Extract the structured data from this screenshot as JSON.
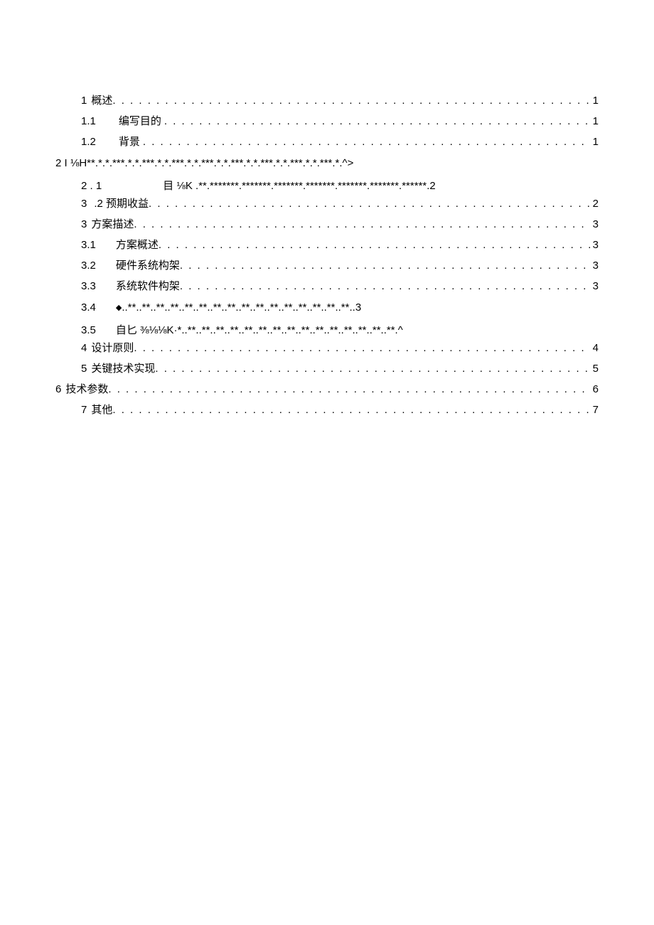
{
  "toc": {
    "items": [
      {
        "kind": "entry",
        "num": "1",
        "title": "概述",
        "page": "1",
        "indent": 1,
        "numPad": 0,
        "titlePad": 0
      },
      {
        "kind": "entry",
        "num": "1.1",
        "title": "编写目的",
        "page": "1",
        "indent": 2,
        "numPad": 32,
        "titlePad": 4
      },
      {
        "kind": "entry",
        "num": "1.2",
        "title": "背景",
        "page": "1",
        "indent": 2,
        "numPad": 32,
        "titlePad": 4
      },
      {
        "kind": "garble",
        "indent": 0,
        "text": "2 I ⅛H**.*.*.***.*.*.***.*.*.***.*.*.***.*.*.***.*.*.***.*.*.***.*.*.***.*.^>"
      },
      {
        "kind": "garble",
        "indent": 2,
        "num": "2  . 1",
        "numPad": 86,
        "text": "目  ⅛K .**.*******.*******.*******.*******.*******.*******.******.2"
      },
      {
        "kind": "entry",
        "num": "3",
        "title": " .2 预期收益",
        "page": "2",
        "indent": 3,
        "numPad": 10,
        "titlePad": 0
      },
      {
        "kind": "entry",
        "num": "3",
        "title": "方案描述",
        "page": "3",
        "indent": 1,
        "numPad": 0,
        "titlePad": 0
      },
      {
        "kind": "entry",
        "num": "3.1",
        "title": "方案概述",
        "page": "3",
        "indent": 2,
        "numPad": 28,
        "titlePad": 0
      },
      {
        "kind": "entry",
        "num": "3.2",
        "title": "硬件系统构架",
        "page": "3",
        "indent": 2,
        "numPad": 28,
        "titlePad": 0
      },
      {
        "kind": "entry",
        "num": "3.3",
        "title": "系统软件构架",
        "page": "3",
        "indent": 2,
        "numPad": 28,
        "titlePad": 0
      },
      {
        "kind": "garble",
        "indent": 2,
        "num": "3.4",
        "numPad": 28,
        "diamond": true,
        "text": "..**..**..**..**..**..**..**..**..**..**..**..**..**..**..**..**..3"
      },
      {
        "kind": "garble",
        "indent": 2,
        "num": "3.5",
        "numPad": 28,
        "text": "自匕 ⅜⅛⅛K·*..**..**..**..**..**..**..**..**..**..**..**..**..**..**..**.^"
      },
      {
        "kind": "entry",
        "num": "4",
        "title": "设计原则",
        "page": "4",
        "indent": 1,
        "numPad": 0,
        "titlePad": 0
      },
      {
        "kind": "entry",
        "num": "5",
        "title": "关键技术实现",
        "page": "5",
        "indent": 1,
        "numPad": 0,
        "titlePad": 0
      },
      {
        "kind": "entry",
        "num": "6",
        "title": "技术参数",
        "page": "6",
        "indent": 0,
        "numPad": 0,
        "titlePad": 0
      },
      {
        "kind": "entry",
        "num": "7",
        "title": "其他",
        "page": "7",
        "indent": 1,
        "numPad": 0,
        "titlePad": 0
      }
    ]
  }
}
